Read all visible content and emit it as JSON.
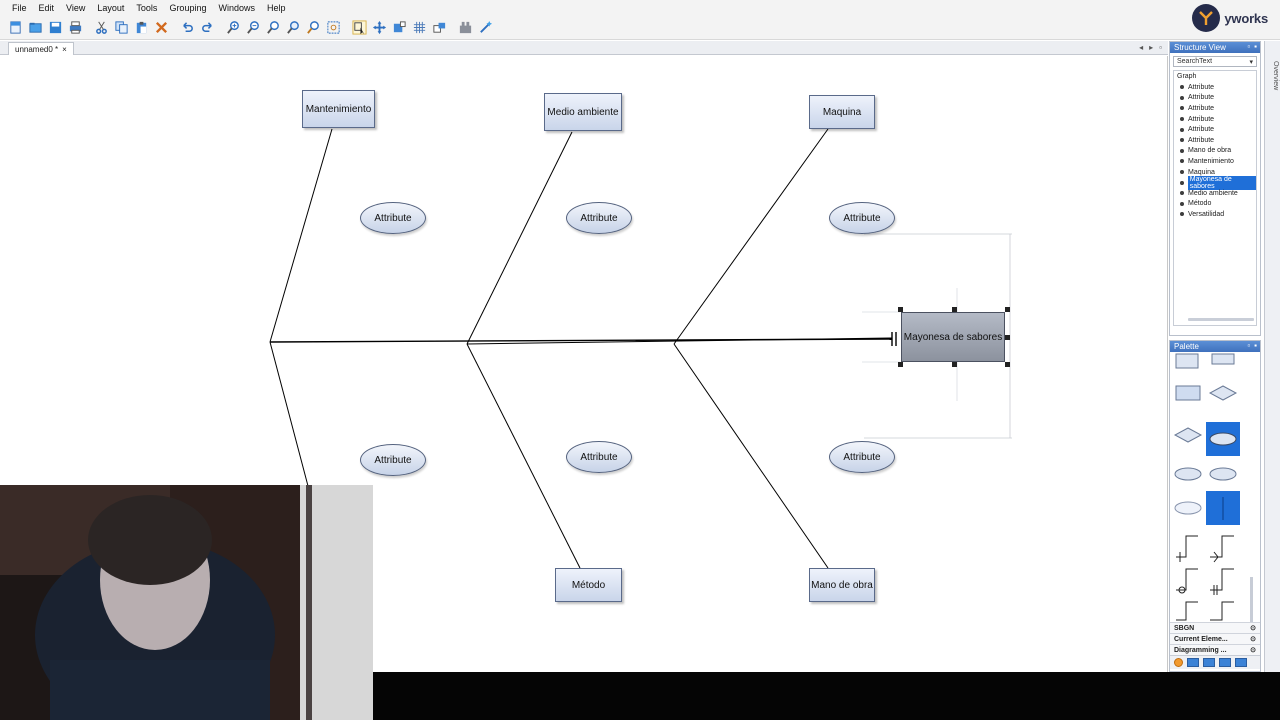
{
  "menu": [
    "File",
    "Edit",
    "View",
    "Layout",
    "Tools",
    "Grouping",
    "Windows",
    "Help"
  ],
  "toolbar_icons": [
    "new-icon",
    "open-icon",
    "save-icon",
    "print-icon",
    "cut-icon",
    "copy-icon",
    "paste-icon",
    "delete-icon",
    "undo-icon",
    "redo-icon",
    "zoom-in-icon",
    "zoom-out-icon",
    "zoom-fit-icon",
    "zoom-original-icon",
    "zoom-area-icon",
    "fit-content-icon",
    "select-mode-icon",
    "move-mode-icon",
    "resize-icon",
    "grid-icon",
    "snap-icon",
    "group-icon",
    "layout-wand-icon"
  ],
  "logo": {
    "text": "yworks"
  },
  "document_tab": {
    "label": "unnamed0 *",
    "close": "×"
  },
  "tab_controls": [
    "◂",
    "▸",
    "▫"
  ],
  "diagram": {
    "categories_top": [
      "Mantenimiento",
      "Medio ambiente",
      "Maquina"
    ],
    "categories_bottom": [
      "Método",
      "Mano de obra"
    ],
    "attribute_label": "Attribute",
    "effect": "Mayonesa de sabores"
  },
  "structure_view": {
    "title": "Structure View",
    "search_placeholder": "SearchText",
    "root": "Graph",
    "items": [
      "Attribute",
      "Attribute",
      "Attribute",
      "Attribute",
      "Attribute",
      "Attribute",
      "Mano de obra",
      "Mantenimiento",
      "Maquina",
      "Mayonesa de sabores",
      "Medio ambiente",
      "Método",
      "Versatilidad"
    ],
    "selected_index": 9
  },
  "overview_label": "Overview",
  "palette": {
    "title": "Palette",
    "sections": [
      "SBGN",
      "Current Eleme...",
      "Diagramming ..."
    ]
  },
  "colors": {
    "panel_title": "#3f71bd",
    "selection": "#1f6fd8",
    "node_fill": "#c9d5ea"
  }
}
